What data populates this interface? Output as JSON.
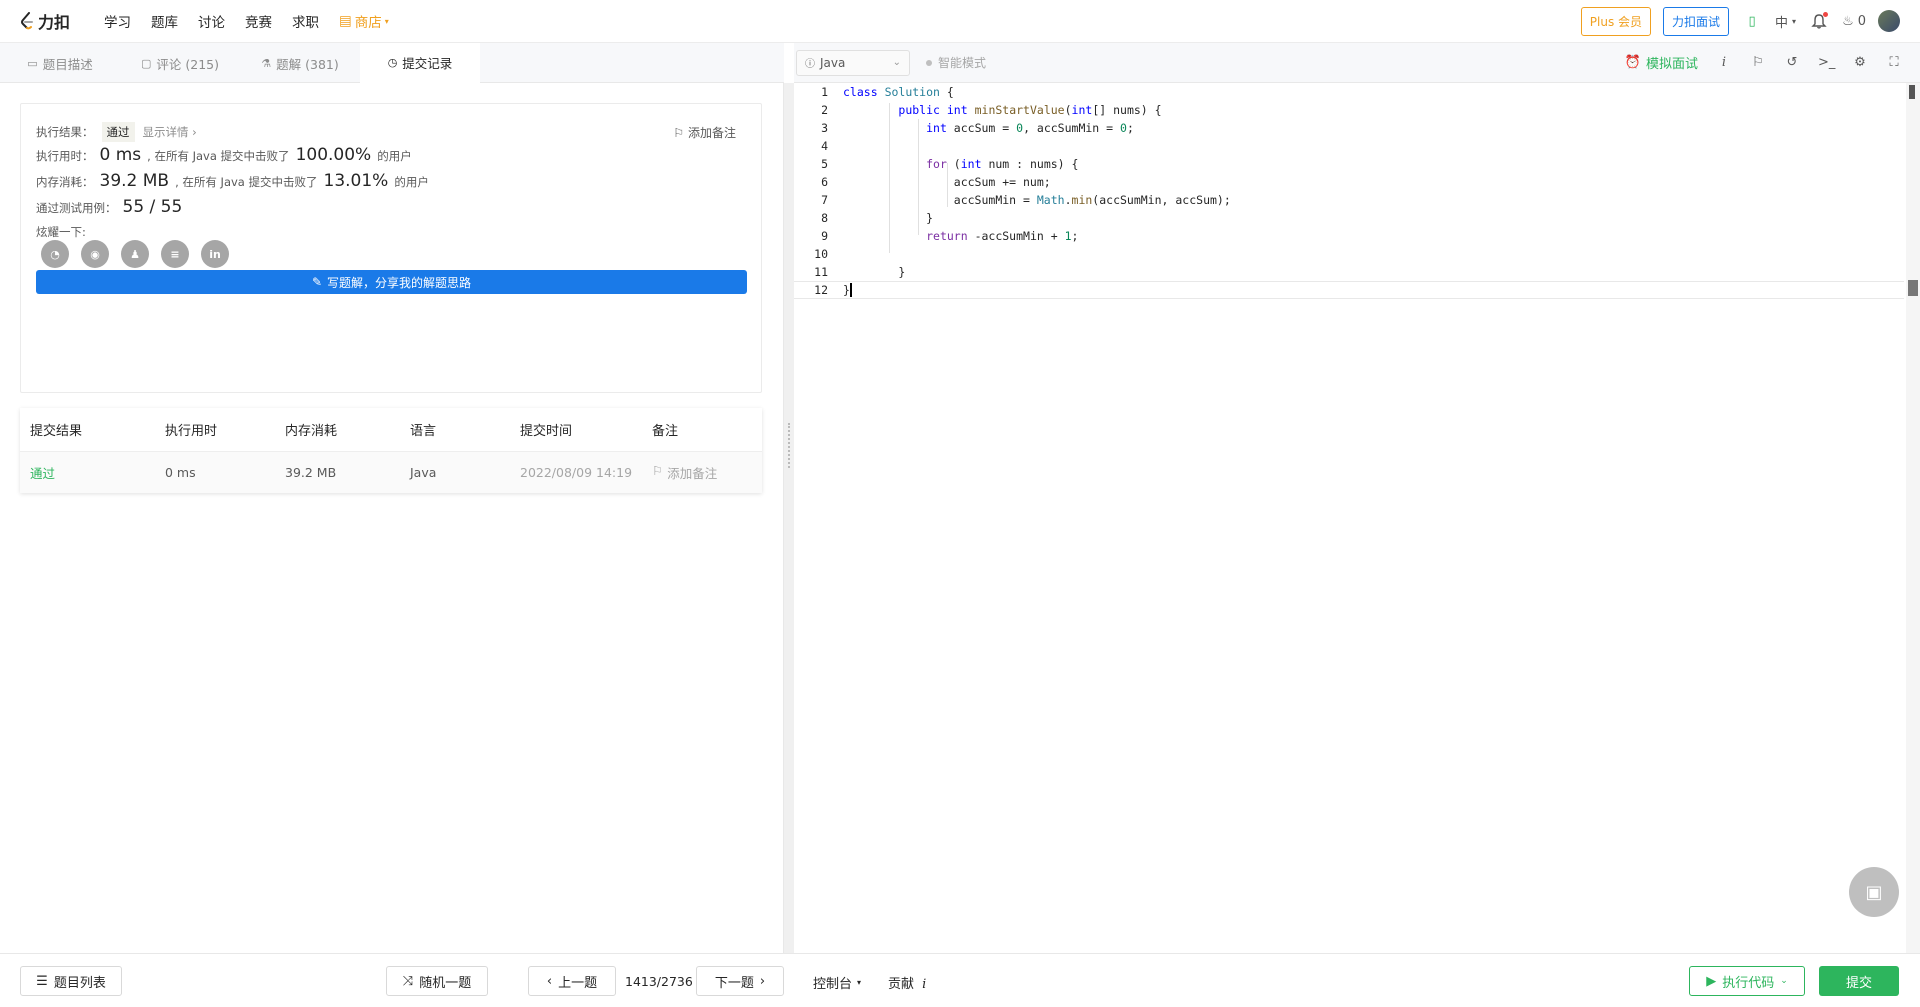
{
  "topnav": {
    "logo_text": "力扣",
    "items": [
      "学习",
      "题库",
      "讨论",
      "竞赛",
      "求职"
    ],
    "store": "商店",
    "plus": "Plus 会员",
    "interview": "力扣面试",
    "lang": "中",
    "points": "0"
  },
  "left_tabs": [
    {
      "label": "题目描述"
    },
    {
      "label": "评论 (215)"
    },
    {
      "label": "题解 (381)"
    },
    {
      "label": "提交记录"
    }
  ],
  "result": {
    "status_label": "执行结果：",
    "status": "通过",
    "detail_link": "显示详情 ›",
    "add_note": "添加备注",
    "time_label": "执行用时：",
    "time_value": "0 ms",
    "time_mid": ", 在所有 Java 提交中击败了",
    "time_pct": "100.00%",
    "users_suffix": "的用户",
    "mem_label": "内存消耗：",
    "mem_value": "39.2 MB",
    "mem_mid": ", 在所有 Java 提交中击败了",
    "mem_pct": "13.01%",
    "tests_label": "通过测试用例：",
    "tests_value": "55 / 55",
    "share_label": "炫耀一下:",
    "write_btn": "写题解，分享我的解题思路"
  },
  "submissions": {
    "headers": [
      "提交结果",
      "执行用时",
      "内存消耗",
      "语言",
      "提交时间",
      "备注"
    ],
    "rows": [
      {
        "result": "通过",
        "time": "0 ms",
        "memory": "39.2 MB",
        "lang": "Java",
        "submitted": "2022/08/09 14:19",
        "note": "添加备注"
      }
    ]
  },
  "editor_toolbar": {
    "language": "Java",
    "smart_mode": "智能模式",
    "mock_interview": "模拟面试"
  },
  "code": {
    "line_numbers": [
      "1",
      "2",
      "3",
      "4",
      "5",
      "6",
      "7",
      "8",
      "9",
      "10",
      "11",
      "12"
    ]
  },
  "bottom": {
    "problem_list": "题目列表",
    "random": "随机一题",
    "prev": "上一题",
    "page": "1413/2736",
    "next": "下一题",
    "console": "控制台",
    "contribute": "贡献",
    "run": "执行代码",
    "submit": "提交"
  },
  "colors": {
    "accent_blue": "#1a7ae8",
    "success_green": "#2db55d",
    "store_orange": "#f0a020"
  }
}
